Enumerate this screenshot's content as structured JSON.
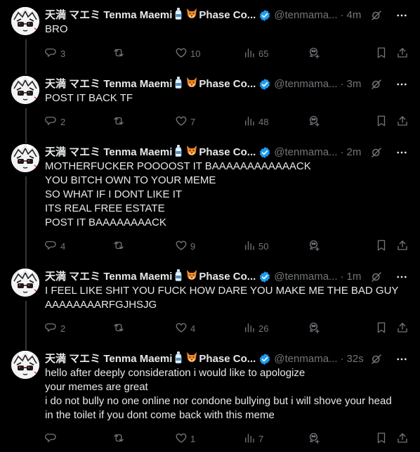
{
  "author": {
    "display_name": "天満 マエミ Tenma Maemi",
    "badge_text": "Phase Co...",
    "handle": "@tenmama...",
    "verified": true,
    "verified_color": "#1d9bf0"
  },
  "icons": {
    "emoji_1": "bottle-emoji",
    "emoji_2": "fox-emoji",
    "reply": "reply-icon",
    "repost": "repost-icon",
    "like": "heart-icon",
    "views": "views-icon",
    "grok": "grok-icon",
    "more": "more-icon",
    "bookmark": "bookmark-icon",
    "share": "share-icon"
  },
  "tweets": [
    {
      "time": "4m",
      "lines": [
        "BRO"
      ],
      "replies": "3",
      "reposts": "",
      "likes": "10",
      "views": "65"
    },
    {
      "time": "3m",
      "lines": [
        "POST IT BACK TF"
      ],
      "replies": "2",
      "reposts": "",
      "likes": "7",
      "views": "48"
    },
    {
      "time": "2m",
      "lines": [
        "MOTHERFUCKER POOOOST IT BAAAAAAAAAAAACK",
        "YOU BITCH OWN TO YOUR MEME",
        "SO WHAT IF I DONT LIKE IT",
        "ITS REAL FREE ESTATE",
        "POST IT BAAAAAAAACK"
      ],
      "replies": "4",
      "reposts": "",
      "likes": "9",
      "views": "50"
    },
    {
      "time": "1m",
      "lines": [
        "I FEEL LIKE SHIT YOU FUCK HOW DARE YOU MAKE ME THE BAD GUY",
        "AAAAAAAARFGJHSJG"
      ],
      "replies": "2",
      "reposts": "",
      "likes": "4",
      "views": "26"
    },
    {
      "time": "32s",
      "lines": [
        "hello after deeply consideration i would like to apologize",
        "your memes are great",
        "i do not bully no one online nor condone bullying but i will shove your head",
        "in the toilet if you dont come back with this meme"
      ],
      "replies": "",
      "reposts": "",
      "likes": "1",
      "views": "7"
    }
  ]
}
